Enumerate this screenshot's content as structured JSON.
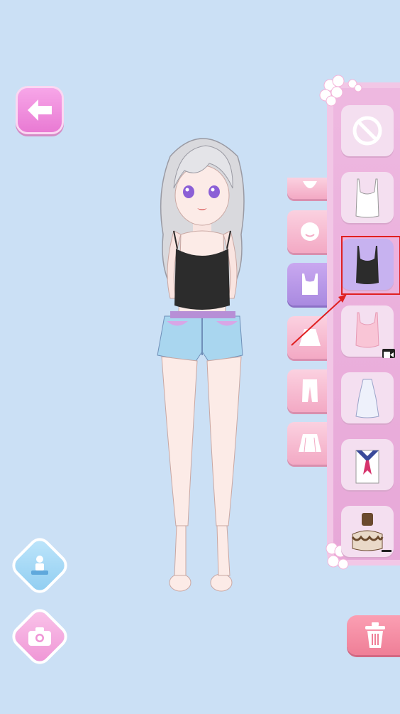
{
  "screen": {
    "background": "#cbe0f5"
  },
  "nav": {
    "back_icon": "arrow-left-icon"
  },
  "left_actions": [
    {
      "name": "pose-button",
      "icon": "figure-icon"
    },
    {
      "name": "camera-button",
      "icon": "camera-icon"
    }
  ],
  "categories": [
    {
      "name": "hair",
      "icon": "hair-icon"
    },
    {
      "name": "face",
      "icon": "face-icon"
    },
    {
      "name": "tops",
      "icon": "tank-top-icon",
      "active": true
    },
    {
      "name": "skirts",
      "icon": "skirt-icon"
    },
    {
      "name": "pants",
      "icon": "pants-icon"
    },
    {
      "name": "dresses",
      "icon": "dress-icon"
    }
  ],
  "items": [
    {
      "name": "none",
      "icon": "no-icon"
    },
    {
      "name": "white-camisole",
      "icon": "white-camisole-icon"
    },
    {
      "name": "black-camisole",
      "icon": "black-camisole-icon",
      "selected": true
    },
    {
      "name": "pink-camisole",
      "icon": "pink-camisole-icon",
      "video_ad": true
    },
    {
      "name": "halter-top",
      "icon": "halter-top-icon"
    },
    {
      "name": "sailor-top",
      "icon": "sailor-top-icon"
    },
    {
      "name": "cake-top",
      "icon": "cake-icon"
    }
  ],
  "colors": {
    "accent_pink": "#e97ad3",
    "panel": "#f2c7e6",
    "selected_item": "#c7b2f0",
    "highlight": "#e02020"
  }
}
